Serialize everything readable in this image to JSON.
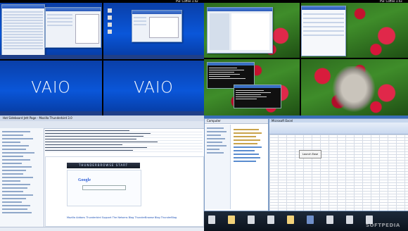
{
  "top_left": {
    "strip_label": "PSF Coffee 1:42",
    "desktops": [
      {
        "logo": "VAIO"
      },
      {
        "logo": "VAIO"
      }
    ]
  },
  "top_right": {
    "strip_label": "PSF Coffee 1:43"
  },
  "thunderbird": {
    "title": "Hot Sideboard Jett Page - Mozilla Thunderbird 3.0",
    "banner": "THUNDERBROWSE START",
    "google_logo": "Google",
    "footer_links": "Mozilla Addons Thunderbird Support The Netsens Blog ThunderBrowse Blog ThunderBlog"
  },
  "excel": {
    "title": "Microsoft Excel",
    "popup_label": "Launch Ease"
  },
  "explorer": {
    "title": "Computer"
  },
  "watermark": "SOFTPEDIA"
}
